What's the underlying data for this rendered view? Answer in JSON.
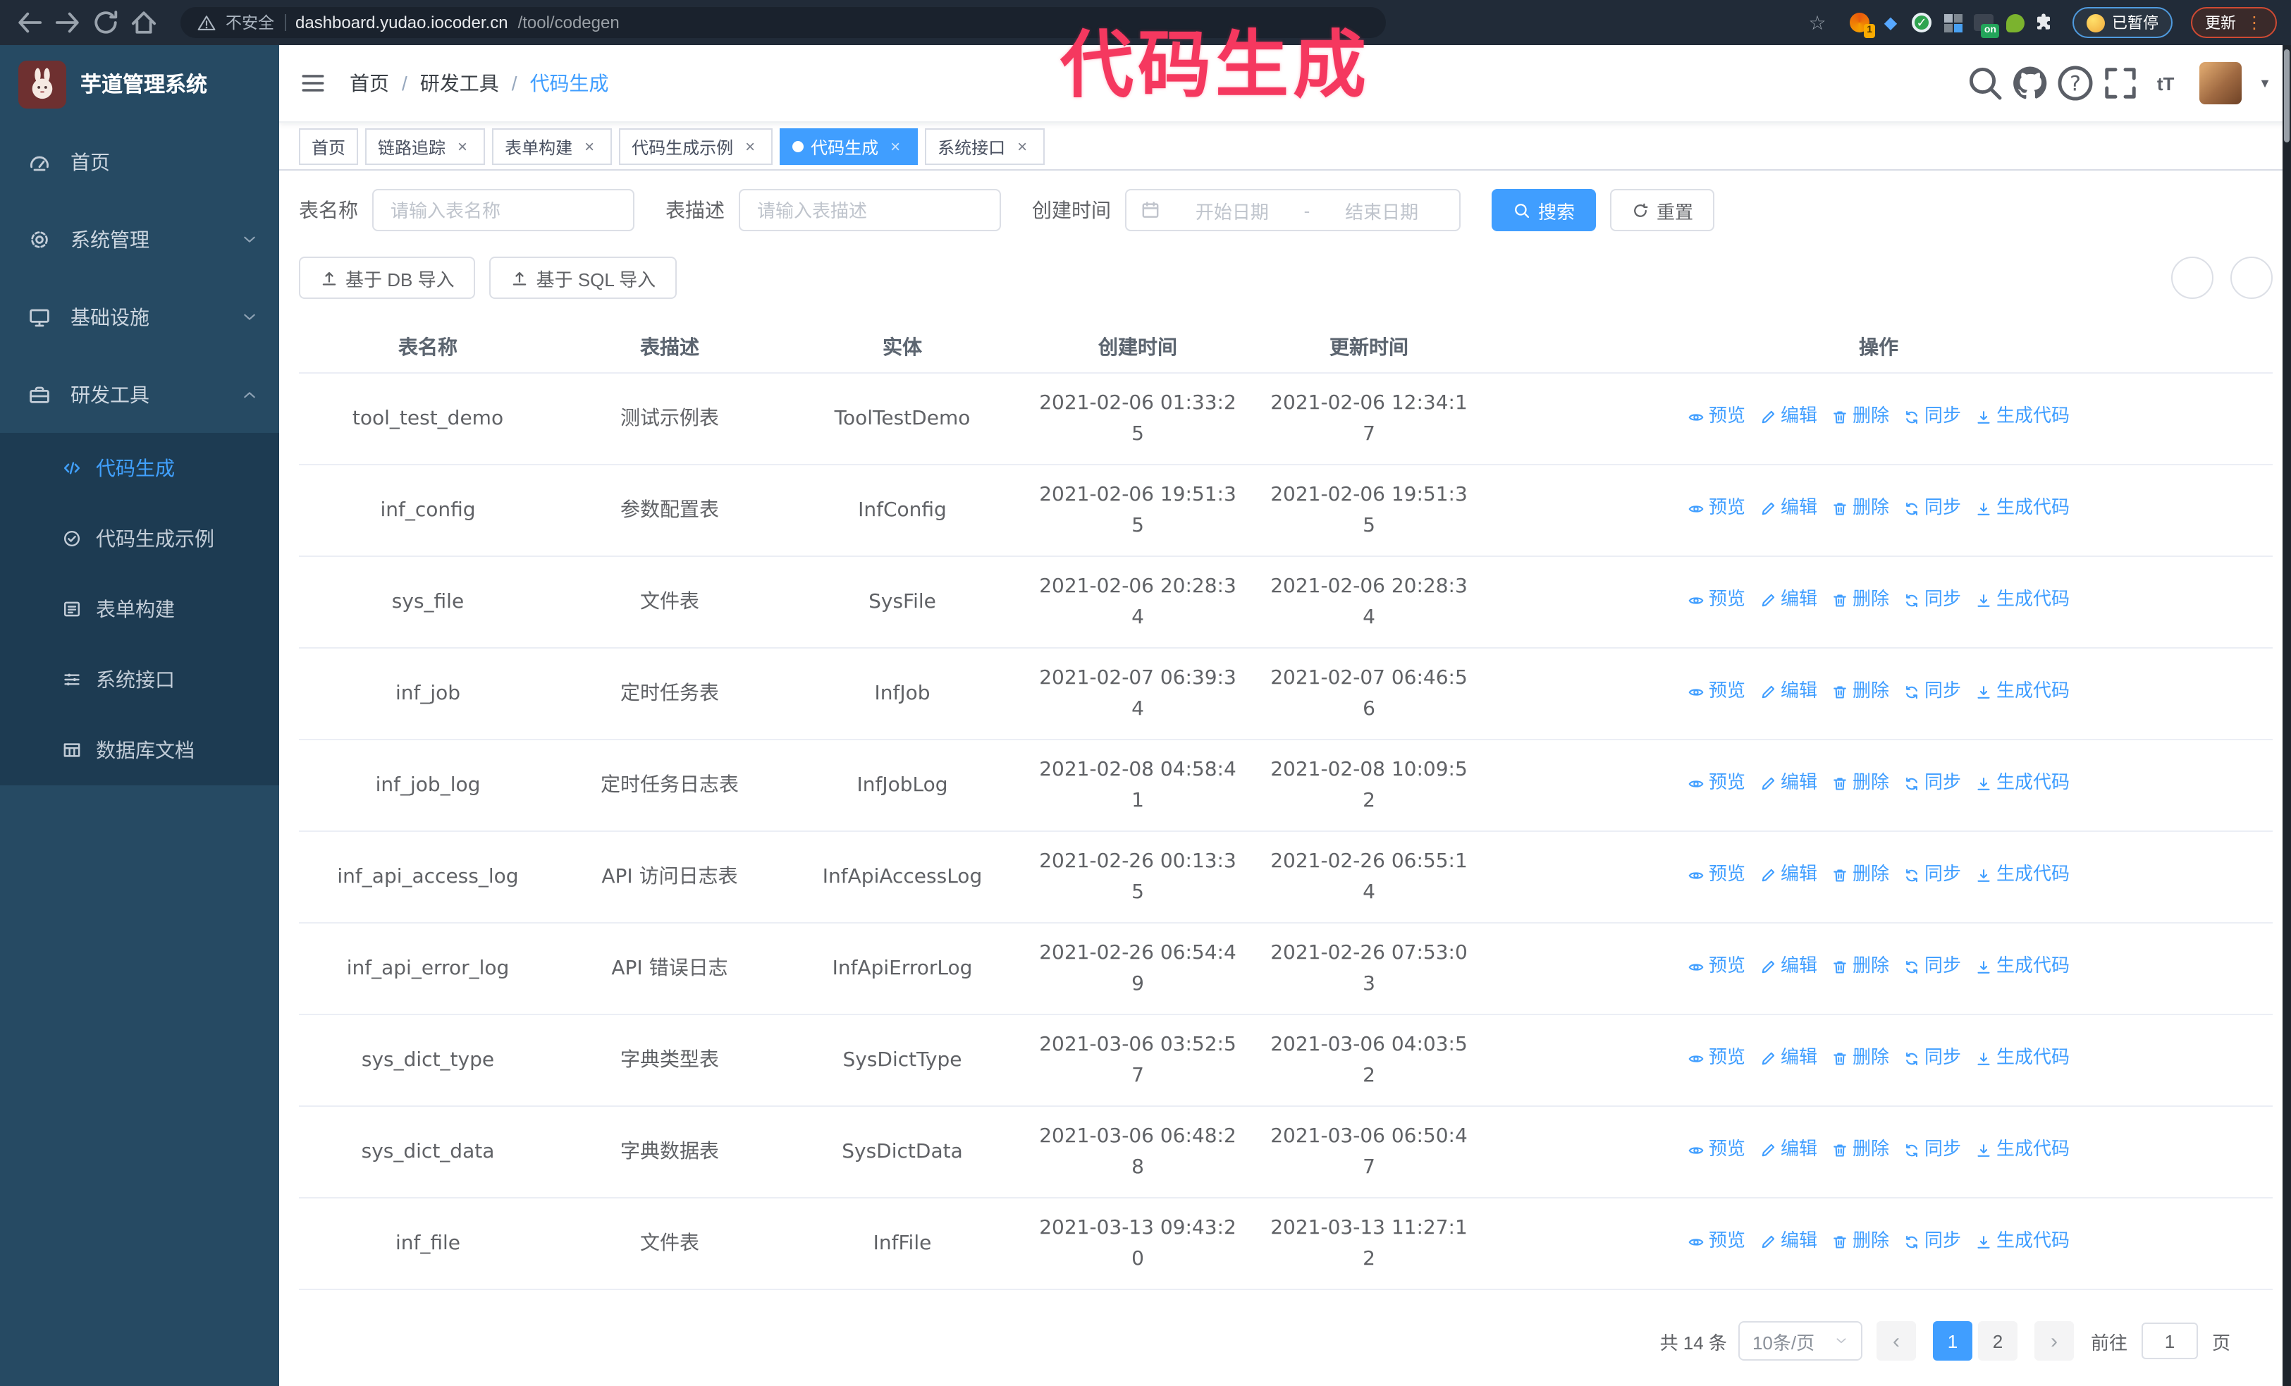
{
  "browser": {
    "security_warning": "不安全",
    "url_host": "dashboard.yudao.iocoder.cn",
    "url_path": "/tool/codegen",
    "extension_badge_count": "1",
    "extension_badge_on": "on",
    "paused_badge": "已暂停",
    "update_badge": "更新"
  },
  "annotation": {
    "text": "代码生成",
    "color": "#f5385f"
  },
  "app": {
    "title": "芋道管理系统",
    "breadcrumb": [
      "首页",
      "研发工具",
      "代码生成"
    ],
    "tabs": [
      {
        "label": "首页",
        "closable": false,
        "active": false
      },
      {
        "label": "链路追踪",
        "closable": true,
        "active": false
      },
      {
        "label": "表单构建",
        "closable": true,
        "active": false
      },
      {
        "label": "代码生成示例",
        "closable": true,
        "active": false
      },
      {
        "label": "代码生成",
        "closable": true,
        "active": true
      },
      {
        "label": "系统接口",
        "closable": true,
        "active": false
      }
    ]
  },
  "sidebar": {
    "items": [
      {
        "label": "首页",
        "icon": "dashboard-icon",
        "type": "item"
      },
      {
        "label": "系统管理",
        "icon": "gear-icon",
        "type": "group",
        "expanded": false
      },
      {
        "label": "基础设施",
        "icon": "monitor-icon",
        "type": "group",
        "expanded": false
      },
      {
        "label": "研发工具",
        "icon": "toolbox-icon",
        "type": "group",
        "expanded": true,
        "children": [
          {
            "label": "代码生成",
            "icon": "code-icon",
            "active": true
          },
          {
            "label": "代码生成示例",
            "icon": "example-check-icon",
            "active": false
          },
          {
            "label": "表单构建",
            "icon": "form-icon",
            "active": false
          },
          {
            "label": "系统接口",
            "icon": "api-list-icon",
            "active": false
          },
          {
            "label": "数据库文档",
            "icon": "database-doc-icon",
            "active": false
          }
        ]
      }
    ]
  },
  "filters": {
    "table_name_label": "表名称",
    "table_name_placeholder": "请输入表名称",
    "table_desc_label": "表描述",
    "table_desc_placeholder": "请输入表描述",
    "create_time_label": "创建时间",
    "date_start_placeholder": "开始日期",
    "date_separator": "-",
    "date_end_placeholder": "结束日期",
    "search_label": "搜索",
    "reset_label": "重置"
  },
  "toolbar": {
    "import_db_label": "基于 DB 导入",
    "import_sql_label": "基于 SQL 导入"
  },
  "table": {
    "columns": [
      "表名称",
      "表描述",
      "实体",
      "创建时间",
      "更新时间",
      "操作"
    ],
    "actions": [
      {
        "label": "预览",
        "name": "preview-link",
        "icon": "eye-icon"
      },
      {
        "label": "编辑",
        "name": "edit-link",
        "icon": "edit-icon"
      },
      {
        "label": "删除",
        "name": "delete-link",
        "icon": "delete-icon"
      },
      {
        "label": "同步",
        "name": "sync-link",
        "icon": "sync-icon"
      },
      {
        "label": "生成代码",
        "name": "generate-code-link",
        "icon": "download-icon"
      }
    ],
    "rows": [
      {
        "name": "tool_test_demo",
        "description": "测试示例表",
        "entity": "ToolTestDemo",
        "create_time": "2021-02-06 01:33:25",
        "update_time": "2021-02-06 12:34:17"
      },
      {
        "name": "inf_config",
        "description": "参数配置表",
        "entity": "InfConfig",
        "create_time": "2021-02-06 19:51:35",
        "update_time": "2021-02-06 19:51:35"
      },
      {
        "name": "sys_file",
        "description": "文件表",
        "entity": "SysFile",
        "create_time": "2021-02-06 20:28:34",
        "update_time": "2021-02-06 20:28:34"
      },
      {
        "name": "inf_job",
        "description": "定时任务表",
        "entity": "InfJob",
        "create_time": "2021-02-07 06:39:34",
        "update_time": "2021-02-07 06:46:56"
      },
      {
        "name": "inf_job_log",
        "description": "定时任务日志表",
        "entity": "InfJobLog",
        "create_time": "2021-02-08 04:58:41",
        "update_time": "2021-02-08 10:09:52"
      },
      {
        "name": "inf_api_access_log",
        "description": "API 访问日志表",
        "entity": "InfApiAccessLog",
        "create_time": "2021-02-26 00:13:35",
        "update_time": "2021-02-26 06:55:14"
      },
      {
        "name": "inf_api_error_log",
        "description": "API 错误日志",
        "entity": "InfApiErrorLog",
        "create_time": "2021-02-26 06:54:49",
        "update_time": "2021-02-26 07:53:03"
      },
      {
        "name": "sys_dict_type",
        "description": "字典类型表",
        "entity": "SysDictType",
        "create_time": "2021-03-06 03:52:57",
        "update_time": "2021-03-06 04:03:52"
      },
      {
        "name": "sys_dict_data",
        "description": "字典数据表",
        "entity": "SysDictData",
        "create_time": "2021-03-06 06:48:28",
        "update_time": "2021-03-06 06:50:47"
      },
      {
        "name": "inf_file",
        "description": "文件表",
        "entity": "InfFile",
        "create_time": "2021-03-13 09:43:20",
        "update_time": "2021-03-13 11:27:12"
      }
    ]
  },
  "pagination": {
    "total_text": "共 14 条",
    "page_size_text": "10条/页",
    "pages": [
      "1",
      "2"
    ],
    "active_page": "1",
    "prev_icon": "‹",
    "next_icon": "›",
    "goto_label": "前往",
    "goto_value": "1",
    "goto_suffix": "页"
  },
  "colors": {
    "primary": "#409eff",
    "sidebar": "#264a63",
    "submenu": "#1d3b52",
    "annotation": "#f5385f"
  }
}
